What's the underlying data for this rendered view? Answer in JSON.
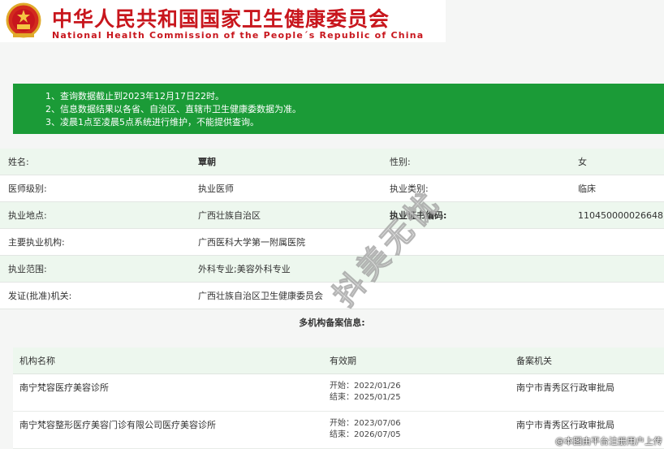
{
  "header": {
    "title_cn": "中华人民共和国国家卫生健康委员会",
    "title_en": "National Health Commission of the People´s Republic of China",
    "emblem_icon": "national-emblem-icon"
  },
  "notice": {
    "lines": [
      "1、查询数据截止到2023年12月17日22时。",
      "2、信息数据结果以各省、自治区、直辖市卫生健康委数据为准。",
      "3、凌晨1点至凌晨5点系统进行维护，不能提供查询。"
    ]
  },
  "info": {
    "name_label": "姓名:",
    "name_value": "覃朝",
    "gender_label": "性别:",
    "gender_value": "女",
    "level_label": "医师级别:",
    "level_value": "执业医师",
    "category_label": "执业类别:",
    "category_value": "临床",
    "location_label": "执业地点:",
    "location_value": "广西壮族自治区",
    "cert_label": "执业证书编码:",
    "cert_value": "110450000026648",
    "institution_label": "主要执业机构:",
    "institution_value": "广西医科大学第一附属医院",
    "scope_label": "执业范围:",
    "scope_value": "外科专业;美容外科专业",
    "issuer_label": "发证(批准)机关:",
    "issuer_value": "广西壮族自治区卫生健康委员会"
  },
  "multi": {
    "title": "多机构备案信息:",
    "headers": [
      "机构名称",
      "有效期",
      "备案机关"
    ],
    "rows": [
      {
        "name": "南宁梵容医疗美容诊所",
        "start": "开始：2022/01/26",
        "end": "结束：2025/01/25",
        "authority": "南宁市青秀区行政审批局"
      },
      {
        "name": "南宁梵容整形医疗美容门诊有限公司医疗美容诊所",
        "start": "开始：2023/07/06",
        "end": "结束：2026/07/05",
        "authority": "南宁市青秀区行政审批局"
      }
    ]
  },
  "watermark": "抖美无忧",
  "footer_mark": "@本图由平台注册用户上传",
  "colors": {
    "brand_red": "#c8161d",
    "notice_green": "#1b9b37",
    "row_alt": "#edf7ee"
  }
}
